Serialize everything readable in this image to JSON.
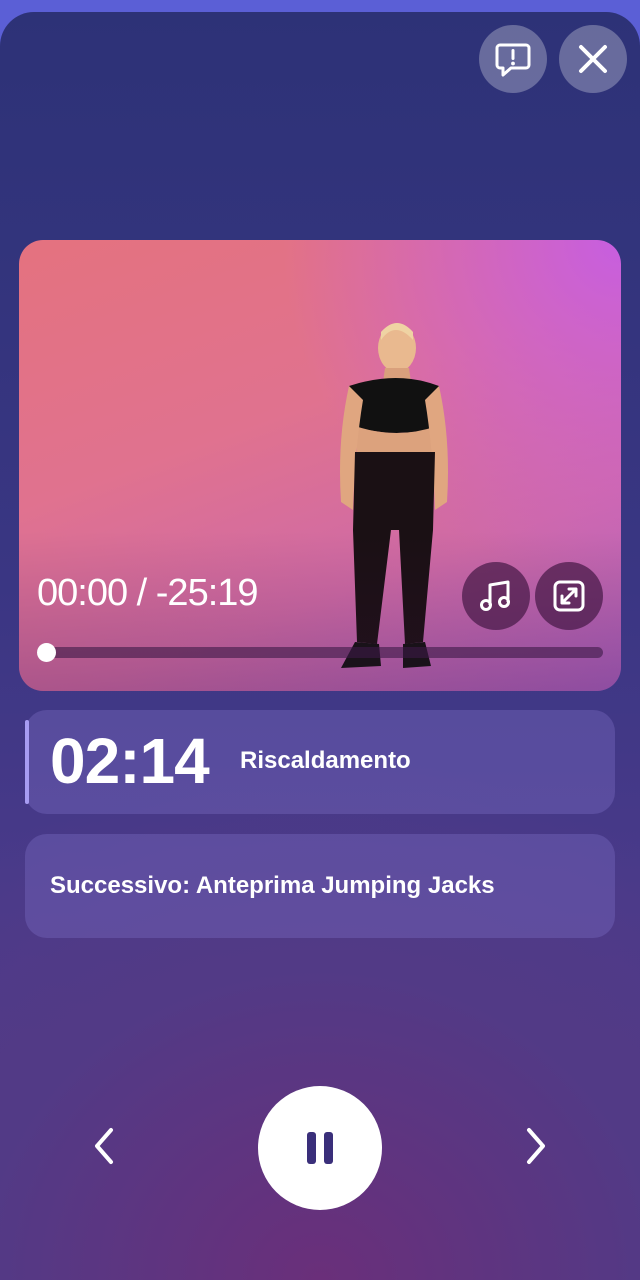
{
  "player": {
    "elapsed": "00:00",
    "separator": "/",
    "remaining": "-25:19",
    "progress_fraction": 0.0
  },
  "current": {
    "countdown": "02:14",
    "phase": "Riscaldamento"
  },
  "next": {
    "label": "Successivo: Anteprima Jumping Jacks"
  },
  "icons": {
    "feedback": "feedback-icon",
    "close": "close-icon",
    "music": "music-note-icon",
    "expand": "expand-icon",
    "previous": "chevron-left-icon",
    "pause": "pause-icon",
    "next": "chevron-right-icon"
  },
  "colors": {
    "accent": "#a79cf2",
    "pause_glyph": "#3a2f7a"
  }
}
